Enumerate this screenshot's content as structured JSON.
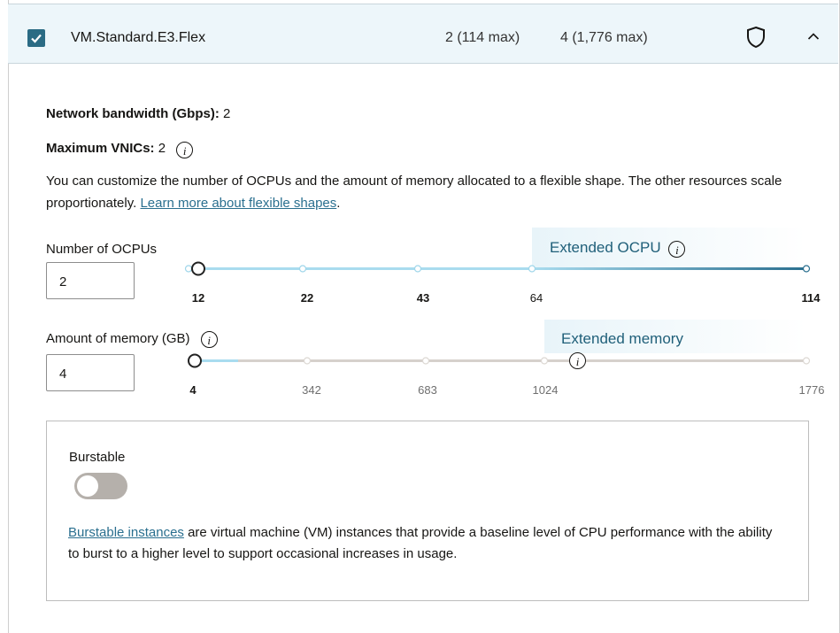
{
  "shape": {
    "name": "VM.Standard.E3.Flex",
    "ocpu": "2 (114 max)",
    "memory": "4 (1,776 max)"
  },
  "details": {
    "network_label": "Network bandwidth (Gbps):",
    "network_value": "2",
    "vnics_label": "Maximum VNICs:",
    "vnics_value": "2",
    "info_glyph": "i",
    "desc_text": "You can customize the number of OCPUs and the amount of memory allocated to a flexible shape. The other resources scale proportionately.",
    "desc_link": "Learn more about flexible shapes",
    "desc_end": "."
  },
  "ocpu_slider": {
    "label": "Number of OCPUs",
    "value": "2",
    "extended_label": "Extended OCPU",
    "ticks": [
      "12",
      "22",
      "43",
      "64",
      "114"
    ],
    "selected": 2,
    "min": 1,
    "max": 114
  },
  "memory_slider": {
    "label": "Amount of memory (GB)",
    "value": "4",
    "extended_label": "Extended memory",
    "ticks": [
      "4",
      "342",
      "683",
      "1024",
      "1776"
    ],
    "selected": 4,
    "min": 1,
    "max": 1776
  },
  "burstable": {
    "label": "Burstable",
    "enabled": false,
    "link": "Burstable instances",
    "text": "are virtual machine (VM) instances that provide a baseline level of CPU performance with the ability to burst to a higher level to support occasional increases in usage."
  },
  "colors": {
    "accent": "#2b6b84",
    "track_active": "#a9dcef",
    "track_extended": "#2a6f8f",
    "track_inactive": "#d6d1cc",
    "link": "#2a6f8f"
  },
  "icons": [
    "checkbox-checked-icon",
    "shield-icon",
    "chevron-up-icon",
    "info-icon"
  ]
}
